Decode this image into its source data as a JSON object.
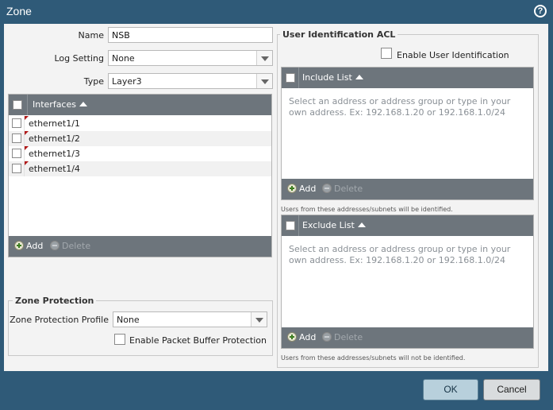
{
  "window": {
    "title": "Zone",
    "help_label": "?"
  },
  "form": {
    "name_label": "Name",
    "name_value": "NSB",
    "log_setting_label": "Log Setting",
    "log_setting_value": "None",
    "type_label": "Type",
    "type_value": "Layer3"
  },
  "interfaces": {
    "header": "Interfaces",
    "rows": [
      "ethernet1/1",
      "ethernet1/2",
      "ethernet1/3",
      "ethernet1/4"
    ],
    "add_label": "Add",
    "delete_label": "Delete"
  },
  "zone_protection": {
    "legend": "Zone Protection",
    "profile_label": "Zone Protection Profile",
    "profile_value": "None",
    "packet_buffer_label": "Enable Packet Buffer Protection"
  },
  "user_id_acl": {
    "legend": "User Identification ACL",
    "enable_label": "Enable User Identification",
    "include": {
      "header": "Include List",
      "placeholder": "Select an address or address group or type in your own address. Ex: 192.168.1.20 or 192.168.1.0/24",
      "add_label": "Add",
      "delete_label": "Delete",
      "note": "Users from these addresses/subnets will be identified."
    },
    "exclude": {
      "header": "Exclude List",
      "placeholder": "Select an address or address group or type in your own address. Ex: 192.168.1.20 or 192.168.1.0/24",
      "add_label": "Add",
      "delete_label": "Delete",
      "note": "Users from these addresses/subnets will not be identified."
    }
  },
  "footer": {
    "ok_label": "OK",
    "cancel_label": "Cancel"
  },
  "icons": [
    "help-icon",
    "checkbox-icon",
    "sort-ascending-icon",
    "add-icon",
    "delete-icon",
    "dropdown-arrow-icon",
    "red-flag-icon"
  ],
  "colors": {
    "titlebar": "#2f5a78",
    "grid_header": "#6d757c",
    "panel": "#f3f3f3",
    "ok_button": "#b8d0dc"
  }
}
